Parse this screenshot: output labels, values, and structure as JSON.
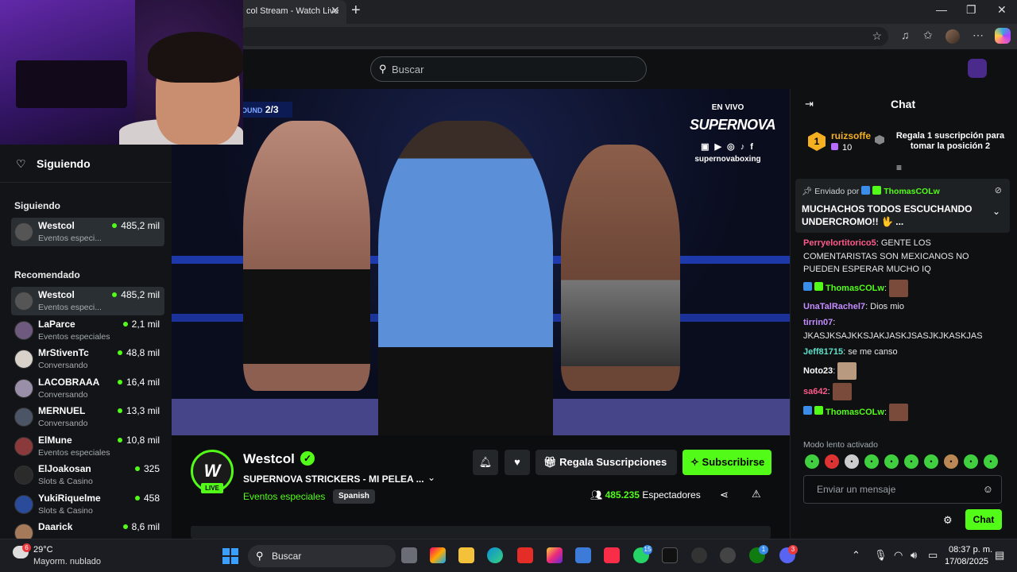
{
  "browser": {
    "tab_title": "col Stream - Watch Live",
    "tab_close": "✕",
    "new_tab": "+"
  },
  "site": {
    "search_placeholder": "Buscar"
  },
  "sidebar": {
    "header": "Siguiendo",
    "following_title": "Siguiendo",
    "following": [
      {
        "name": "Westcol",
        "category": "Eventos especi...",
        "viewers": "485,2 mil"
      }
    ],
    "recommended_title": "Recomendado",
    "recommended": [
      {
        "name": "Westcol",
        "category": "Eventos especi...",
        "viewers": "485,2 mil"
      },
      {
        "name": "LaParce",
        "category": "Eventos especiales",
        "viewers": "2,1 mil"
      },
      {
        "name": "MrStivenTc",
        "category": "Conversando",
        "viewers": "48,8 mil"
      },
      {
        "name": "LACOBRAAA",
        "category": "Conversando",
        "viewers": "16,4 mil"
      },
      {
        "name": "MERNUEL",
        "category": "Conversando",
        "viewers": "13,3 mil"
      },
      {
        "name": "ElMune",
        "category": "Eventos especiales",
        "viewers": "10,8 mil"
      },
      {
        "name": "ElJoakosan",
        "category": "Slots & Casino",
        "viewers": "325"
      },
      {
        "name": "YukiRiquelme",
        "category": "Slots & Casino",
        "viewers": "458"
      },
      {
        "name": "Daarick",
        "category": "",
        "viewers": "8,6 mil"
      }
    ]
  },
  "video": {
    "round_label": "OUND",
    "round_value": "2/3",
    "overlay_live": "EN VIVO",
    "overlay_brand": "SUPERNOVA",
    "overlay_handle": "supernovaboxing"
  },
  "stream": {
    "logo_text": "W",
    "live_badge": "LIVE",
    "channel": "Westcol",
    "title": "SUPERNOVA STRICKERS - MI PELEA ...",
    "category": "Eventos especiales",
    "language": "Spanish",
    "gift_label": "Regala Suscripciones",
    "subscribe_label": "Subscribirse",
    "viewer_count": "485.235",
    "viewer_label": "Espectadores"
  },
  "chat": {
    "title": "Chat",
    "leader_rank": "1",
    "leader_name": "ruizsoffe",
    "leader_count": "10",
    "leader_cta": "Regala 1 suscripción para tomar la posición 2",
    "pinned_prefix": "Enviado por",
    "pinned_user": "ThomasCOLw",
    "pinned_message": "MUCHACHOS TODOS ESCUCHANDO UNDERCROMO!! 🖖 ...",
    "messages": [
      {
        "user": "Perryelortitorico5",
        "color": "#ff5a8a",
        "text": ": GENTE LOS COMENTARISTAS SON MEXICANOS NO PUEDEN ESPERAR MUCHO IQ"
      },
      {
        "user": "ThomasCOLw",
        "color": "#53fc18",
        "text": ":"
      },
      {
        "user": "UnaTalRachel7",
        "color": "#c58cff",
        "text": ": Dios mio"
      },
      {
        "user": "tirrin07",
        "color": "#c58cff",
        "text": ": JKASJKSAJKKSJAKJASKJSASJKJKASKJAS"
      },
      {
        "user": "Jeff81715",
        "color": "#5ee0c8",
        "text": ": se me canso"
      },
      {
        "user": "Noto23",
        "color": "#ffffff",
        "text": ":"
      },
      {
        "user": "sa642",
        "color": "#ff5a8a",
        "text": ":"
      },
      {
        "user": "ThomasCOLw",
        "color": "#53fc18",
        "text": ":"
      }
    ],
    "slow_mode": "Modo lento activado",
    "input_placeholder": "Enviar un mensaje",
    "send_label": "Chat"
  },
  "taskbar": {
    "temperature": "29°C",
    "weather": "Mayorm. nublado",
    "weather_badge": "6",
    "search_label": "Buscar",
    "whatsapp_badge": "15",
    "xbox_badge": "1",
    "discord_badge": "3",
    "time": "08:37 p. m.",
    "date": "17/08/2025"
  }
}
